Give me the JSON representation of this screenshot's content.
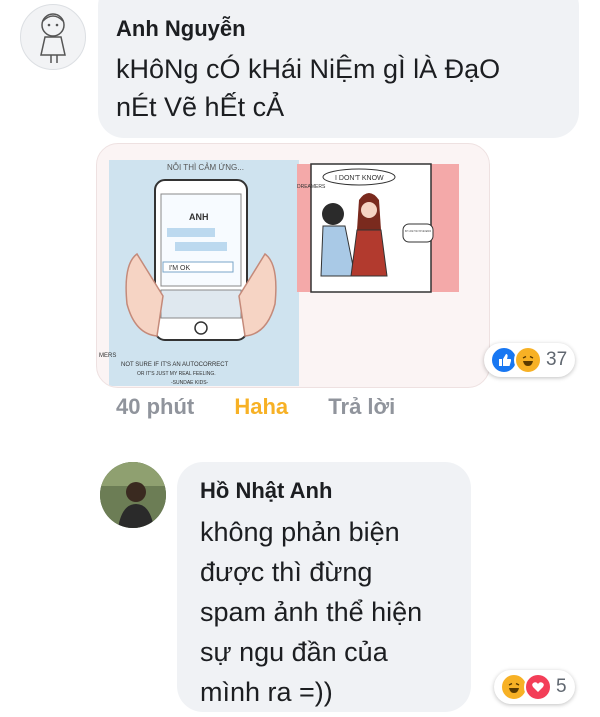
{
  "comments": [
    {
      "author": "Anh Nguyễn",
      "text": "kHôNg cÓ kHái NiỆm gÌ lÀ ĐạO\nnÉt Vẽ hẾt cẢ",
      "reaction_count": "37",
      "reaction_icons": [
        "like-icon",
        "haha-icon"
      ],
      "actions": {
        "time": "40 phút",
        "reaction": "Haha",
        "reply": "Trả lời"
      },
      "attachment": {
        "panel_left": {
          "heading": "NỖI THÌ CẢM ỨNG...",
          "contact": "ANH",
          "input_text": "I'M OK",
          "caption": "NOT SURE IF IT'S AN AUTOCORRECT",
          "caption2": "OR IT'S JUST MY REAL FEELING.",
          "signature": "-SUNDAE KIDS-",
          "side_mark": "MERS"
        },
        "panel_right": {
          "bubble_1": "I DON'T KNOW",
          "bubble_2": "BUT I LOVE IT WHY I'M THE REASON",
          "corner_tag": "DREAMERS"
        }
      }
    },
    {
      "author": "Hồ Nhật Anh",
      "text": "không phản biện\nđược thì đừng\nspam ảnh thể hiện\nsự ngu đần của\nmình ra =))",
      "reaction_count": "5",
      "reaction_icons": [
        "haha-icon",
        "love-icon"
      ]
    }
  ],
  "colors": {
    "bubble": "#f0f2f5",
    "haha_accent": "#f7b125",
    "meta_text": "#90949c",
    "like_blue": "#1877f2",
    "love_red": "#f33e58"
  }
}
